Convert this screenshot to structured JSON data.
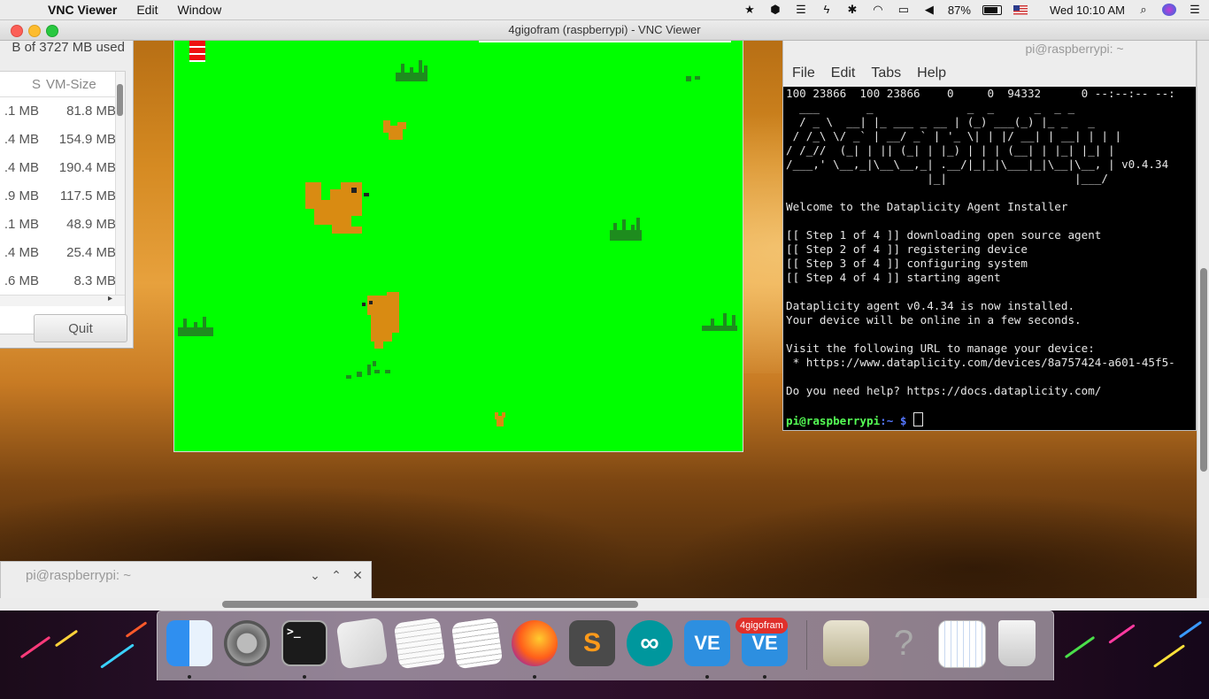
{
  "menubar": {
    "apple_glyph": "",
    "app_name": "VNC Viewer",
    "menus": [
      "Edit",
      "Window"
    ],
    "battery": "87%",
    "clock": "Wed 10:10 AM"
  },
  "vnc": {
    "window_title": "4gigofram (raspberrypi) - VNC Viewer"
  },
  "task_manager": {
    "memory_used": "B of 3727 MB used",
    "columns": [
      "S",
      "VM-Size"
    ],
    "rows": [
      {
        "rss": ".1 MB",
        "vm": "81.8 MB"
      },
      {
        "rss": ".4 MB",
        "vm": "154.9 MB"
      },
      {
        "rss": ".4 MB",
        "vm": "190.4 MB"
      },
      {
        "rss": ".9 MB",
        "vm": "117.5 MB"
      },
      {
        "rss": ".1 MB",
        "vm": "48.9 MB"
      },
      {
        "rss": ".4 MB",
        "vm": "25.4 MB"
      },
      {
        "rss": ".6 MB",
        "vm": "8.3 MB"
      }
    ],
    "quit_label": "Quit"
  },
  "terminal": {
    "title": "pi@raspberrypi: ~",
    "menu": [
      "File",
      "Edit",
      "Tabs",
      "Help"
    ],
    "lines": [
      "100 23866  100 23866    0     0  94332      0 --:--:-- --:",
      "  ___       _              _  _      _  _ _",
      "  / _ \\  __| |_ ___ _ __ | (_) ___(_) |_ _   _",
      " / /_\\ \\/ _` | __/ _` | '_ \\| | |/ __| | __| | | |",
      "/ /_//  (_| | || (_| | |_) | | | (__| | |_| |_| |",
      "/___,' \\__,_|\\__\\__,_| .__/|_|_|\\___|_|\\__|\\__, | v0.4.34",
      "                     |_|                   |___/",
      "",
      "Welcome to the Dataplicity Agent Installer",
      "",
      "[[ Step 1 of 4 ]] downloading open source agent",
      "[[ Step 2 of 4 ]] registering device",
      "[[ Step 3 of 4 ]] configuring system",
      "[[ Step 4 of 4 ]] starting agent",
      "",
      "Dataplicity agent v0.4.34 is now installed.",
      "Your device will be online in a few seconds.",
      "",
      "Visit the following URL to manage your device:",
      " * https://www.dataplicity.com/devices/8a757424-a601-45f5-",
      "",
      "Do you need help? https://docs.dataplicity.com/",
      ""
    ],
    "prompt_user": "pi@raspberrypi",
    "prompt_path": ":~ $"
  },
  "mini_terminal": {
    "title": "pi@raspberrypi: ~",
    "buttons": [
      "⌄",
      "⌃",
      "✕"
    ]
  },
  "dock": {
    "items": [
      {
        "name": "finder",
        "label": ""
      },
      {
        "name": "system-preferences",
        "label": ""
      },
      {
        "name": "terminal",
        "label": ">_"
      },
      {
        "name": "script-editor",
        "label": ""
      },
      {
        "name": "textedit-preview",
        "label": ""
      },
      {
        "name": "textedit",
        "label": ""
      },
      {
        "name": "firefox",
        "label": ""
      },
      {
        "name": "sublime-text",
        "label": "S"
      },
      {
        "name": "arduino",
        "label": "∞"
      },
      {
        "name": "vnc-viewer",
        "label": "VE"
      },
      {
        "name": "vnc-viewer-4gigofram",
        "label": "VE"
      },
      {
        "name": "preview",
        "label": ""
      },
      {
        "name": "help",
        "label": "?"
      },
      {
        "name": "calendar",
        "label": ""
      },
      {
        "name": "trash",
        "label": ""
      }
    ],
    "badge": "4gigofram"
  },
  "colors": {
    "game_bg": "#00ff00",
    "squirrel": "#d98b12",
    "grass": "#1e8c1e",
    "lives": "#ee1111"
  }
}
